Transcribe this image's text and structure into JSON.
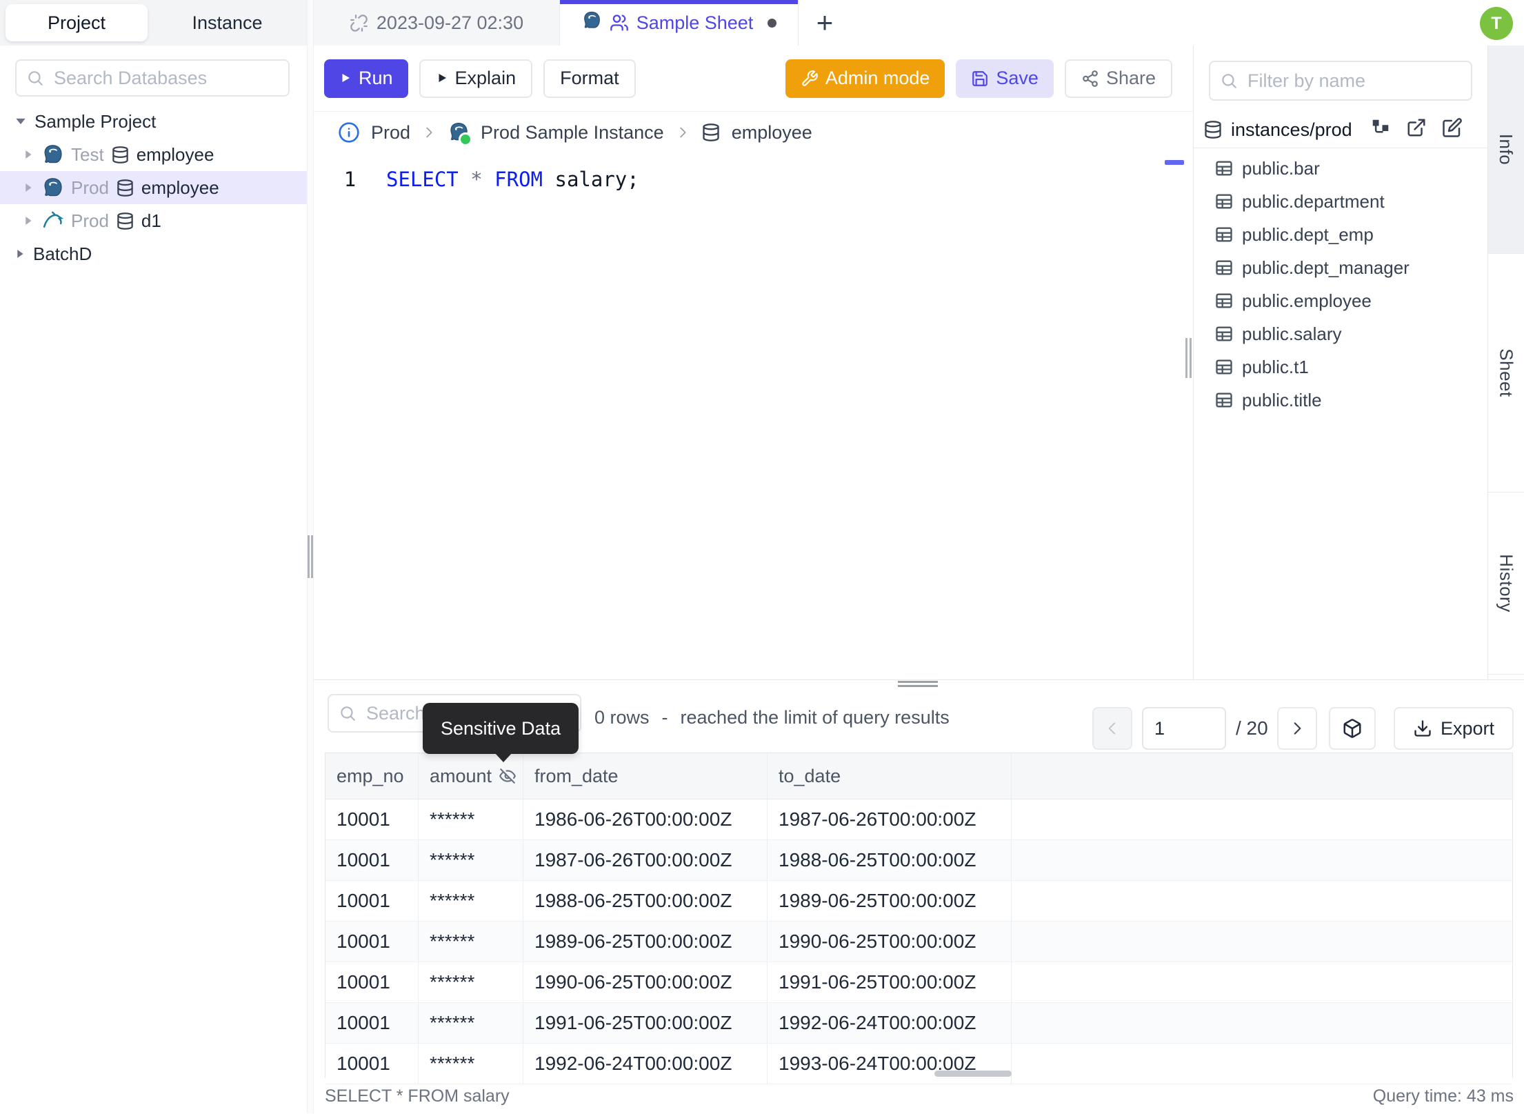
{
  "colors": {
    "accent": "#4f46e5",
    "accent_soft": "#e4e2fb",
    "admin_orange": "#efa00b",
    "avatar_green": "#7cc241",
    "keyword_blue": "#0d1ef0",
    "selected_tree": "#e9e8fc",
    "tooltip_bg": "#28282b",
    "status_green": "#34c759",
    "pg_blue": "#336791",
    "mysql_teal": "#1b7e9e"
  },
  "sidebar": {
    "tabs": [
      {
        "label": "Project"
      },
      {
        "label": "Instance"
      }
    ],
    "search_placeholder": "Search Databases",
    "tree_items": [
      {
        "label": "Sample Project"
      },
      {
        "env": "Test",
        "db": "employee"
      },
      {
        "env": "Prod",
        "db": "employee"
      },
      {
        "env": "Prod",
        "db": "d1"
      },
      {
        "label": "BatchD"
      }
    ]
  },
  "tabbar": {
    "time_tab": "2023-09-27 02:30",
    "sheet_tab": "Sample Sheet",
    "new_tab": "+"
  },
  "avatar": "T",
  "toolbar": {
    "run": "Run",
    "explain": "Explain",
    "format": "Format",
    "admin_mode": "Admin mode",
    "save": "Save",
    "share": "Share"
  },
  "breadcrumb": {
    "environment": "Prod",
    "instance": "Prod Sample Instance",
    "database": "employee"
  },
  "editor": {
    "line_number": "1",
    "keyword_select": "SELECT",
    "star": "*",
    "keyword_from": "FROM",
    "rest": "salary;"
  },
  "right_panel": {
    "filter_placeholder": "Filter by name",
    "header": "instances/prod",
    "tables": [
      "public.bar",
      "public.department",
      "public.dept_emp",
      "public.dept_manager",
      "public.employee",
      "public.salary",
      "public.t1",
      "public.title"
    ]
  },
  "side_tabs": [
    "Info",
    "Sheet",
    "History"
  ],
  "results": {
    "search_placeholder": "Search",
    "tooltip": "Sensitive Data",
    "rows_count": "0 rows",
    "dash": "-",
    "limit_text": "reached the limit of query results",
    "page": "1",
    "page_total": "/ 20",
    "export": "Export",
    "columns": [
      "emp_no",
      "amount",
      "from_date",
      "to_date"
    ],
    "rows": [
      [
        "10001",
        "******",
        "1986-06-26T00:00:00Z",
        "1987-06-26T00:00:00Z"
      ],
      [
        "10001",
        "******",
        "1987-06-26T00:00:00Z",
        "1988-06-25T00:00:00Z"
      ],
      [
        "10001",
        "******",
        "1988-06-25T00:00:00Z",
        "1989-06-25T00:00:00Z"
      ],
      [
        "10001",
        "******",
        "1989-06-25T00:00:00Z",
        "1990-06-25T00:00:00Z"
      ],
      [
        "10001",
        "******",
        "1990-06-25T00:00:00Z",
        "1991-06-25T00:00:00Z"
      ],
      [
        "10001",
        "******",
        "1991-06-25T00:00:00Z",
        "1992-06-24T00:00:00Z"
      ],
      [
        "10001",
        "******",
        "1992-06-24T00:00:00Z",
        "1993-06-24T00:00:00Z"
      ]
    ],
    "status_query": "SELECT * FROM salary",
    "query_time": "Query time: 43 ms"
  }
}
